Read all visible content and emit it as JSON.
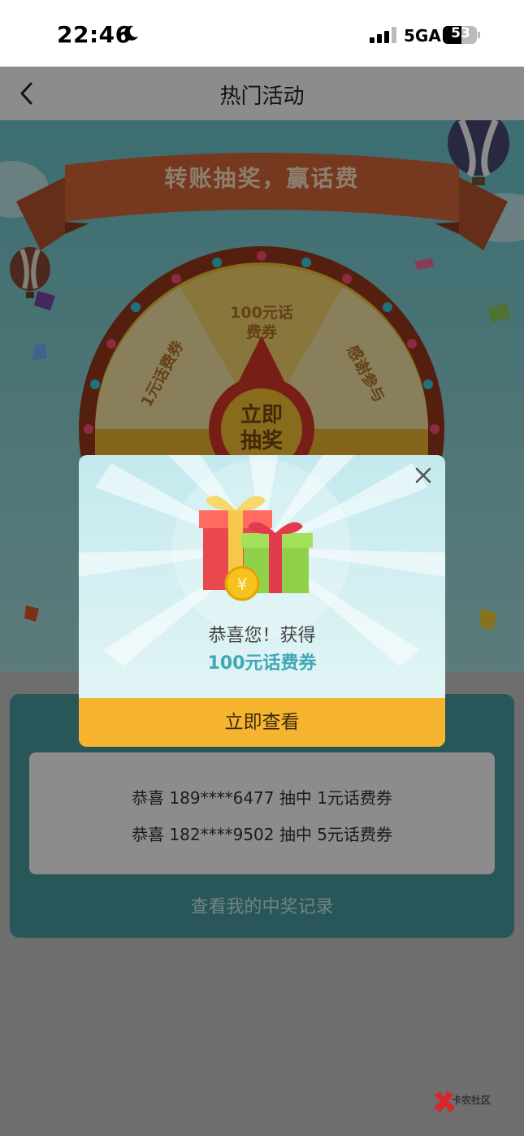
{
  "status": {
    "time": "22:46",
    "network": "5GA",
    "battery": "53"
  },
  "nav": {
    "title": "热门活动"
  },
  "activity": {
    "banner": "转账抽奖，赢话费",
    "wheel": {
      "segments": [
        "100元话\n费券",
        "1元话费券",
        "感谢参与"
      ],
      "draw_button": "立即\n抽奖"
    },
    "records": [
      "恭喜 189****6477 抽中 1元话费券",
      "恭喜 182****9502 抽中 5元话费券"
    ],
    "my_records": "查看我的中奖记录"
  },
  "modal": {
    "congrats": "恭喜您！获得",
    "prize": "100元话费券",
    "button": "立即查看"
  },
  "watermark": {
    "text": "卡农社区"
  }
}
